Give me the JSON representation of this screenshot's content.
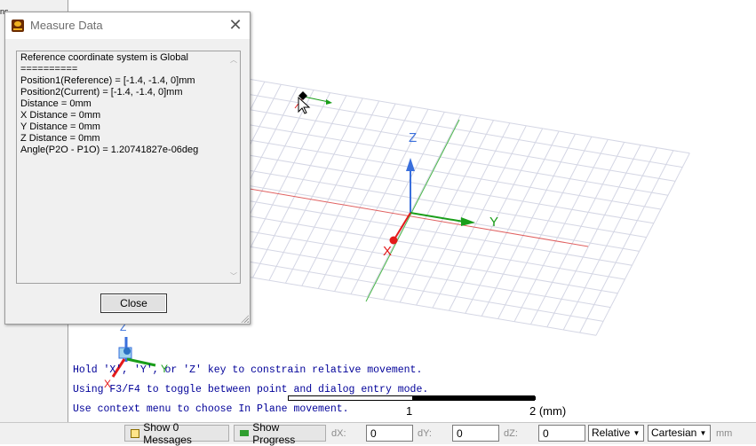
{
  "background_label": "ns",
  "dialog": {
    "title": "Measure Data",
    "lines": [
      "Reference coordinate system is Global",
      "==========",
      "Position1(Reference) = [-1.4, -1.4, 0]mm",
      "Position2(Current) = [-1.4, -1.4, 0]mm",
      "Distance = 0mm",
      "X Distance = 0mm",
      "Y Distance = 0mm",
      "Z Distance = 0mm",
      "Angle(P2O - P1O) = 1.20741827e-06deg"
    ],
    "close_label": "Close",
    "close_glyph": "✕"
  },
  "viewport": {
    "axis_labels": {
      "x": "X",
      "y": "Y",
      "z": "Z"
    },
    "triad_labels": {
      "x": "X",
      "y": "Y",
      "z": "Z"
    },
    "hints": [
      "Hold 'X', 'Y', or 'Z' key to constrain relative movement.",
      "Using F3/F4 to toggle between point and dialog entry mode.",
      "Use context menu to choose In Plane movement."
    ],
    "scale": {
      "tick_1": "1",
      "tick_2": "2 (mm)"
    },
    "colors": {
      "x_axis": "#e41a1a",
      "y_axis": "#1a9e1a",
      "z_axis": "#3a6fdc",
      "grid": "#d4d6e4"
    }
  },
  "statusbar": {
    "messages_label": "Show 0 Messages",
    "progress_label": "Show Progress",
    "dx_label": "dX:",
    "dx_value": "0",
    "dy_label": "dY:",
    "dy_value": "0",
    "dz_label": "dZ:",
    "dz_value": "0",
    "mode_value": "Relative",
    "coord_value": "Cartesian",
    "unit": "mm"
  }
}
